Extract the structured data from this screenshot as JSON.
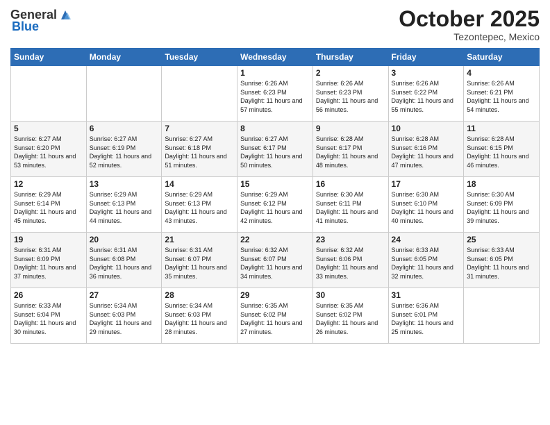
{
  "header": {
    "logo_general": "General",
    "logo_blue": "Blue",
    "month": "October 2025",
    "location": "Tezontepec, Mexico"
  },
  "weekdays": [
    "Sunday",
    "Monday",
    "Tuesday",
    "Wednesday",
    "Thursday",
    "Friday",
    "Saturday"
  ],
  "weeks": [
    [
      {
        "day": "",
        "sunrise": "",
        "sunset": "",
        "daylight": ""
      },
      {
        "day": "",
        "sunrise": "",
        "sunset": "",
        "daylight": ""
      },
      {
        "day": "",
        "sunrise": "",
        "sunset": "",
        "daylight": ""
      },
      {
        "day": "1",
        "sunrise": "Sunrise: 6:26 AM",
        "sunset": "Sunset: 6:23 PM",
        "daylight": "Daylight: 11 hours and 57 minutes."
      },
      {
        "day": "2",
        "sunrise": "Sunrise: 6:26 AM",
        "sunset": "Sunset: 6:23 PM",
        "daylight": "Daylight: 11 hours and 56 minutes."
      },
      {
        "day": "3",
        "sunrise": "Sunrise: 6:26 AM",
        "sunset": "Sunset: 6:22 PM",
        "daylight": "Daylight: 11 hours and 55 minutes."
      },
      {
        "day": "4",
        "sunrise": "Sunrise: 6:26 AM",
        "sunset": "Sunset: 6:21 PM",
        "daylight": "Daylight: 11 hours and 54 minutes."
      }
    ],
    [
      {
        "day": "5",
        "sunrise": "Sunrise: 6:27 AM",
        "sunset": "Sunset: 6:20 PM",
        "daylight": "Daylight: 11 hours and 53 minutes."
      },
      {
        "day": "6",
        "sunrise": "Sunrise: 6:27 AM",
        "sunset": "Sunset: 6:19 PM",
        "daylight": "Daylight: 11 hours and 52 minutes."
      },
      {
        "day": "7",
        "sunrise": "Sunrise: 6:27 AM",
        "sunset": "Sunset: 6:18 PM",
        "daylight": "Daylight: 11 hours and 51 minutes."
      },
      {
        "day": "8",
        "sunrise": "Sunrise: 6:27 AM",
        "sunset": "Sunset: 6:17 PM",
        "daylight": "Daylight: 11 hours and 50 minutes."
      },
      {
        "day": "9",
        "sunrise": "Sunrise: 6:28 AM",
        "sunset": "Sunset: 6:17 PM",
        "daylight": "Daylight: 11 hours and 48 minutes."
      },
      {
        "day": "10",
        "sunrise": "Sunrise: 6:28 AM",
        "sunset": "Sunset: 6:16 PM",
        "daylight": "Daylight: 11 hours and 47 minutes."
      },
      {
        "day": "11",
        "sunrise": "Sunrise: 6:28 AM",
        "sunset": "Sunset: 6:15 PM",
        "daylight": "Daylight: 11 hours and 46 minutes."
      }
    ],
    [
      {
        "day": "12",
        "sunrise": "Sunrise: 6:29 AM",
        "sunset": "Sunset: 6:14 PM",
        "daylight": "Daylight: 11 hours and 45 minutes."
      },
      {
        "day": "13",
        "sunrise": "Sunrise: 6:29 AM",
        "sunset": "Sunset: 6:13 PM",
        "daylight": "Daylight: 11 hours and 44 minutes."
      },
      {
        "day": "14",
        "sunrise": "Sunrise: 6:29 AM",
        "sunset": "Sunset: 6:13 PM",
        "daylight": "Daylight: 11 hours and 43 minutes."
      },
      {
        "day": "15",
        "sunrise": "Sunrise: 6:29 AM",
        "sunset": "Sunset: 6:12 PM",
        "daylight": "Daylight: 11 hours and 42 minutes."
      },
      {
        "day": "16",
        "sunrise": "Sunrise: 6:30 AM",
        "sunset": "Sunset: 6:11 PM",
        "daylight": "Daylight: 11 hours and 41 minutes."
      },
      {
        "day": "17",
        "sunrise": "Sunrise: 6:30 AM",
        "sunset": "Sunset: 6:10 PM",
        "daylight": "Daylight: 11 hours and 40 minutes."
      },
      {
        "day": "18",
        "sunrise": "Sunrise: 6:30 AM",
        "sunset": "Sunset: 6:09 PM",
        "daylight": "Daylight: 11 hours and 39 minutes."
      }
    ],
    [
      {
        "day": "19",
        "sunrise": "Sunrise: 6:31 AM",
        "sunset": "Sunset: 6:09 PM",
        "daylight": "Daylight: 11 hours and 37 minutes."
      },
      {
        "day": "20",
        "sunrise": "Sunrise: 6:31 AM",
        "sunset": "Sunset: 6:08 PM",
        "daylight": "Daylight: 11 hours and 36 minutes."
      },
      {
        "day": "21",
        "sunrise": "Sunrise: 6:31 AM",
        "sunset": "Sunset: 6:07 PM",
        "daylight": "Daylight: 11 hours and 35 minutes."
      },
      {
        "day": "22",
        "sunrise": "Sunrise: 6:32 AM",
        "sunset": "Sunset: 6:07 PM",
        "daylight": "Daylight: 11 hours and 34 minutes."
      },
      {
        "day": "23",
        "sunrise": "Sunrise: 6:32 AM",
        "sunset": "Sunset: 6:06 PM",
        "daylight": "Daylight: 11 hours and 33 minutes."
      },
      {
        "day": "24",
        "sunrise": "Sunrise: 6:33 AM",
        "sunset": "Sunset: 6:05 PM",
        "daylight": "Daylight: 11 hours and 32 minutes."
      },
      {
        "day": "25",
        "sunrise": "Sunrise: 6:33 AM",
        "sunset": "Sunset: 6:05 PM",
        "daylight": "Daylight: 11 hours and 31 minutes."
      }
    ],
    [
      {
        "day": "26",
        "sunrise": "Sunrise: 6:33 AM",
        "sunset": "Sunset: 6:04 PM",
        "daylight": "Daylight: 11 hours and 30 minutes."
      },
      {
        "day": "27",
        "sunrise": "Sunrise: 6:34 AM",
        "sunset": "Sunset: 6:03 PM",
        "daylight": "Daylight: 11 hours and 29 minutes."
      },
      {
        "day": "28",
        "sunrise": "Sunrise: 6:34 AM",
        "sunset": "Sunset: 6:03 PM",
        "daylight": "Daylight: 11 hours and 28 minutes."
      },
      {
        "day": "29",
        "sunrise": "Sunrise: 6:35 AM",
        "sunset": "Sunset: 6:02 PM",
        "daylight": "Daylight: 11 hours and 27 minutes."
      },
      {
        "day": "30",
        "sunrise": "Sunrise: 6:35 AM",
        "sunset": "Sunset: 6:02 PM",
        "daylight": "Daylight: 11 hours and 26 minutes."
      },
      {
        "day": "31",
        "sunrise": "Sunrise: 6:36 AM",
        "sunset": "Sunset: 6:01 PM",
        "daylight": "Daylight: 11 hours and 25 minutes."
      },
      {
        "day": "",
        "sunrise": "",
        "sunset": "",
        "daylight": ""
      }
    ]
  ]
}
